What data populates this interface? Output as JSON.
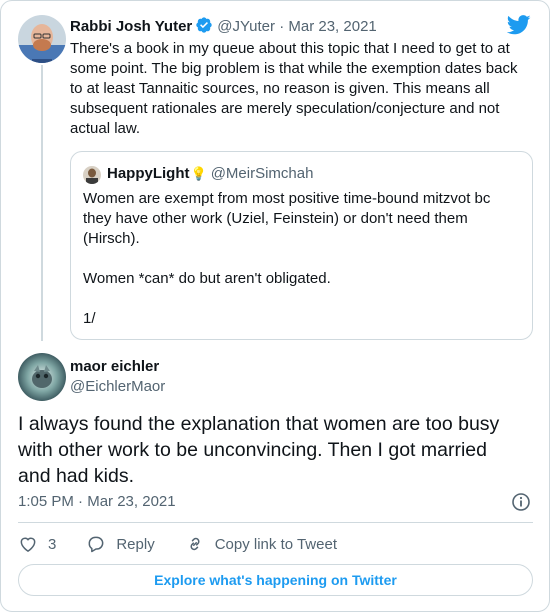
{
  "parent_tweet": {
    "display_name": "Rabbi Josh Yuter",
    "handle": "@JYuter",
    "separator": "·",
    "date": "Mar 23, 2021",
    "text_lines": [
      "There's a book in my queue about this topic that I need to get to at",
      "some point. The big problem is that while the exemption dates back",
      "to at least Tannaitic sources, no reason is given. This means all",
      "subsequent rationales are merely speculation/conjecture and not",
      "actual law."
    ]
  },
  "quoted_tweet": {
    "display_name": "HappyLight",
    "handle": "@MeirSimchah",
    "lines": [
      "Women are exempt from most positive time-bound mitzvot bc",
      "they have other work (Uziel, Feinstein) or don't need them",
      "(Hirsch).",
      "",
      "Women *can* do but aren't obligated.",
      "",
      "1/"
    ]
  },
  "main_tweet": {
    "display_name": "maor eichler",
    "handle": "@EichlerMaor",
    "text_lines": [
      "I always found the explanation that women are too busy",
      "with other work to be unconvincing. Then I got married",
      "and had kids."
    ],
    "time": "1:05 PM",
    "separator": "·",
    "date": "Mar 23, 2021"
  },
  "actions": {
    "like_count": "3",
    "reply_label": "Reply",
    "copy_link_label": "Copy link to Tweet"
  },
  "explore_label": "Explore what's happening on Twitter",
  "colors": {
    "accent": "#1d9bf0",
    "text": "#0f1419",
    "muted": "#536471",
    "border": "#cfd9de"
  },
  "icons": [
    "verified-badge-icon",
    "twitter-bird-icon",
    "lightbulb-icon",
    "info-icon",
    "heart-icon",
    "reply-icon",
    "link-icon"
  ]
}
